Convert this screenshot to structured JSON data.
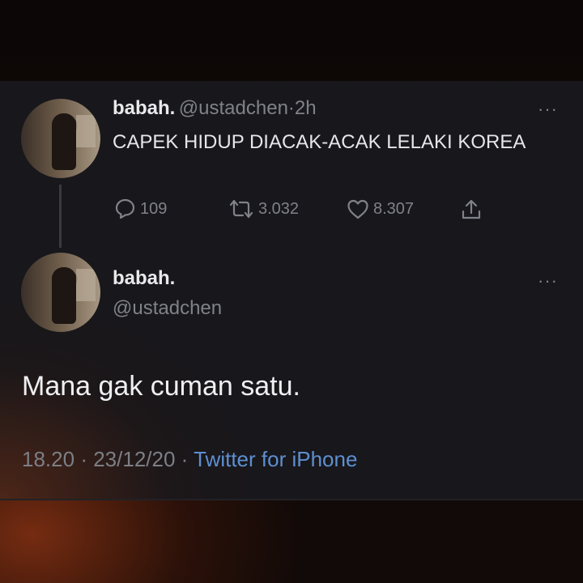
{
  "tweet1": {
    "name": "babah.",
    "handle": "@ustadchen",
    "dot": "·",
    "time": "2h",
    "text": "CAPEK HIDUP DIACAK-ACAK LELAKI KOREA",
    "replies": "109",
    "retweets": "3.032",
    "likes": "8.307",
    "more": "···"
  },
  "tweet2": {
    "name": "babah.",
    "handle": "@ustadchen",
    "text": "Mana gak cuman satu.",
    "more": "···",
    "meta": {
      "time": "18.20",
      "date": "23/12/20",
      "source": "Twitter for iPhone",
      "dot": "·"
    }
  },
  "icons": [
    "reply-icon",
    "retweet-icon",
    "like-icon",
    "share-icon",
    "more-icon"
  ]
}
